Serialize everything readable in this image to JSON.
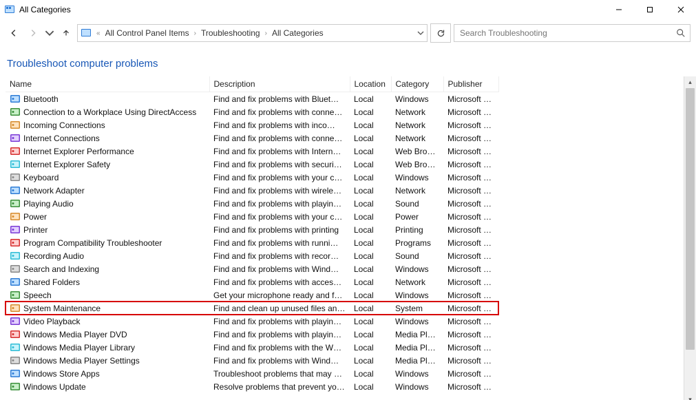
{
  "window": {
    "title": "All Categories"
  },
  "breadcrumb": {
    "items": [
      "All Control Panel Items",
      "Troubleshooting",
      "All Categories"
    ]
  },
  "search": {
    "placeholder": "Search Troubleshooting"
  },
  "heading": "Troubleshoot computer problems",
  "columns": {
    "name": "Name",
    "description": "Description",
    "location": "Location",
    "category": "Category",
    "publisher": "Publisher"
  },
  "rows": [
    {
      "name": "Bluetooth",
      "desc": "Find and fix problems with Bluet…",
      "loc": "Local",
      "cat": "Windows",
      "pub": "Microsoft …",
      "highlight": false
    },
    {
      "name": "Connection to a Workplace Using DirectAccess",
      "desc": "Find and fix problems with conne…",
      "loc": "Local",
      "cat": "Network",
      "pub": "Microsoft …",
      "highlight": false
    },
    {
      "name": "Incoming Connections",
      "desc": "Find and fix problems with inco…",
      "loc": "Local",
      "cat": "Network",
      "pub": "Microsoft …",
      "highlight": false
    },
    {
      "name": "Internet Connections",
      "desc": "Find and fix problems with conne…",
      "loc": "Local",
      "cat": "Network",
      "pub": "Microsoft …",
      "highlight": false
    },
    {
      "name": "Internet Explorer Performance",
      "desc": "Find and fix problems with Intern…",
      "loc": "Local",
      "cat": "Web Brow…",
      "pub": "Microsoft …",
      "highlight": false
    },
    {
      "name": "Internet Explorer Safety",
      "desc": "Find and fix problems with securi…",
      "loc": "Local",
      "cat": "Web Brow…",
      "pub": "Microsoft …",
      "highlight": false
    },
    {
      "name": "Keyboard",
      "desc": "Find and fix problems with your c…",
      "loc": "Local",
      "cat": "Windows",
      "pub": "Microsoft …",
      "highlight": false
    },
    {
      "name": "Network Adapter",
      "desc": "Find and fix problems with wirele…",
      "loc": "Local",
      "cat": "Network",
      "pub": "Microsoft …",
      "highlight": false
    },
    {
      "name": "Playing Audio",
      "desc": "Find and fix problems with playin…",
      "loc": "Local",
      "cat": "Sound",
      "pub": "Microsoft …",
      "highlight": false
    },
    {
      "name": "Power",
      "desc": "Find and fix problems with your c…",
      "loc": "Local",
      "cat": "Power",
      "pub": "Microsoft …",
      "highlight": false
    },
    {
      "name": "Printer",
      "desc": "Find and fix problems with printing",
      "loc": "Local",
      "cat": "Printing",
      "pub": "Microsoft …",
      "highlight": false
    },
    {
      "name": "Program Compatibility Troubleshooter",
      "desc": "Find and fix problems with runni…",
      "loc": "Local",
      "cat": "Programs",
      "pub": "Microsoft …",
      "highlight": false
    },
    {
      "name": "Recording Audio",
      "desc": "Find and fix problems with recor…",
      "loc": "Local",
      "cat": "Sound",
      "pub": "Microsoft …",
      "highlight": false
    },
    {
      "name": "Search and Indexing",
      "desc": "Find and fix problems with Wind…",
      "loc": "Local",
      "cat": "Windows",
      "pub": "Microsoft …",
      "highlight": false
    },
    {
      "name": "Shared Folders",
      "desc": "Find and fix problems with acces…",
      "loc": "Local",
      "cat": "Network",
      "pub": "Microsoft …",
      "highlight": false
    },
    {
      "name": "Speech",
      "desc": "Get your microphone ready and f…",
      "loc": "Local",
      "cat": "Windows",
      "pub": "Microsoft …",
      "highlight": false
    },
    {
      "name": "System Maintenance",
      "desc": "Find and clean up unused files an…",
      "loc": "Local",
      "cat": "System",
      "pub": "Microsoft …",
      "highlight": true
    },
    {
      "name": "Video Playback",
      "desc": "Find and fix problems with playin…",
      "loc": "Local",
      "cat": "Windows",
      "pub": "Microsoft …",
      "highlight": false
    },
    {
      "name": "Windows Media Player DVD",
      "desc": "Find and fix problems with playin…",
      "loc": "Local",
      "cat": "Media Pla…",
      "pub": "Microsoft …",
      "highlight": false
    },
    {
      "name": "Windows Media Player Library",
      "desc": "Find and fix problems with the W…",
      "loc": "Local",
      "cat": "Media Pla…",
      "pub": "Microsoft …",
      "highlight": false
    },
    {
      "name": "Windows Media Player Settings",
      "desc": "Find and fix problems with Wind…",
      "loc": "Local",
      "cat": "Media Pla…",
      "pub": "Microsoft …",
      "highlight": false
    },
    {
      "name": "Windows Store Apps",
      "desc": "Troubleshoot problems that may …",
      "loc": "Local",
      "cat": "Windows",
      "pub": "Microsoft …",
      "highlight": false
    },
    {
      "name": "Windows Update",
      "desc": "Resolve problems that prevent yo…",
      "loc": "Local",
      "cat": "Windows",
      "pub": "Microsoft …",
      "highlight": false
    }
  ]
}
